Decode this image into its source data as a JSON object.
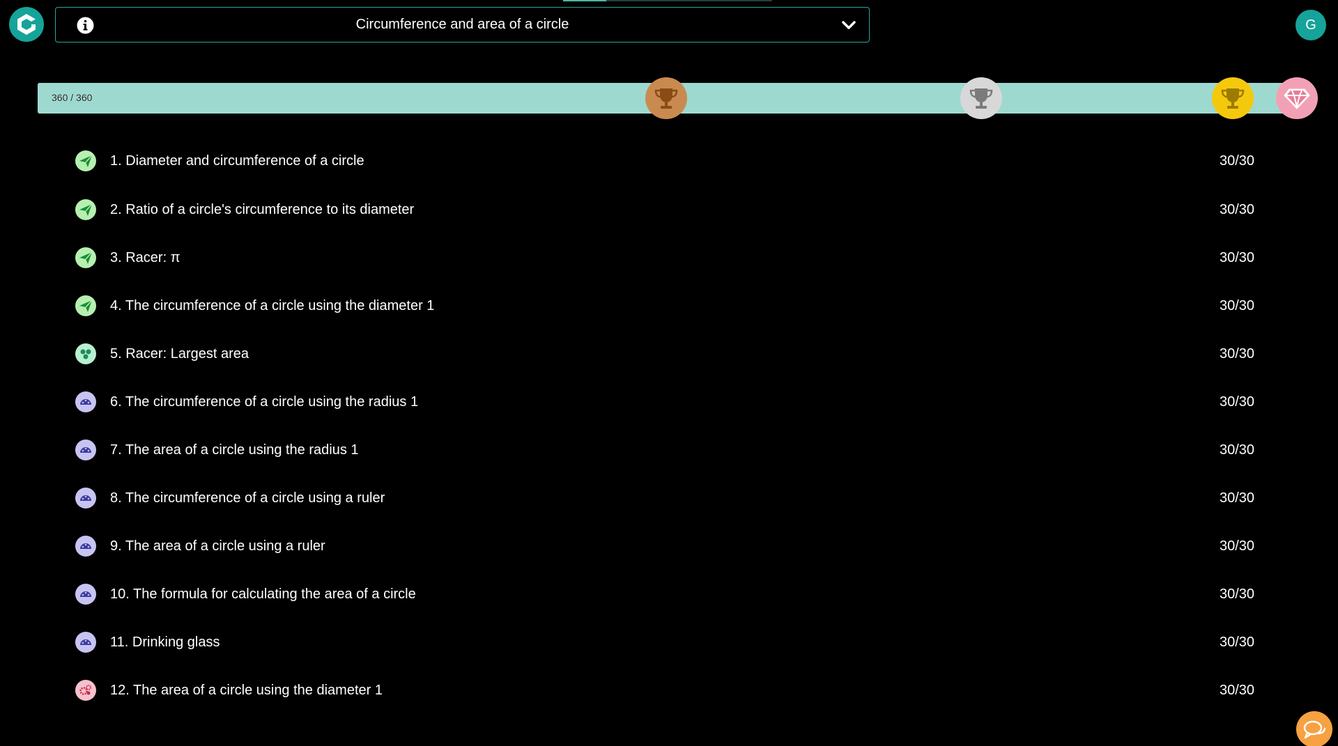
{
  "header": {
    "topic_title": "Circumference and area of a circle",
    "avatar_initial": "G"
  },
  "progress": {
    "label": "360 / 360",
    "value": 360,
    "max": 360
  },
  "colors": {
    "accent": "#26a69a",
    "progress": "#9ed9d0",
    "bronze": "#c98a4f",
    "silver": "#d8d8d8",
    "gold": "#f4c90d",
    "diamond": "#f2a1b5",
    "chat": "#f6a142"
  },
  "lessons": [
    {
      "label": "1. Diameter and circumference of a circle",
      "score": "30/30",
      "icon": "paper-plane-icon"
    },
    {
      "label": "2. Ratio of a circle's circumference to its diameter",
      "score": "30/30",
      "icon": "paper-plane-icon"
    },
    {
      "label": "3. Racer: π",
      "score": "30/30",
      "icon": "paper-plane-icon"
    },
    {
      "label": "4. The circumference of a circle using the diameter 1",
      "score": "30/30",
      "icon": "paper-plane-icon"
    },
    {
      "label": "5. Racer: Largest area",
      "score": "30/30",
      "icon": "racer-icon"
    },
    {
      "label": "6. The circumference of a circle using the radius 1",
      "score": "30/30",
      "icon": "gauge-icon"
    },
    {
      "label": "7. The area of a circle using the radius 1",
      "score": "30/30",
      "icon": "gauge-icon"
    },
    {
      "label": "8. The circumference of a circle using a ruler",
      "score": "30/30",
      "icon": "gauge-icon"
    },
    {
      "label": "9. The area of a circle using a ruler",
      "score": "30/30",
      "icon": "gauge-icon"
    },
    {
      "label": "10. The formula for calculating the area of a circle",
      "score": "30/30",
      "icon": "gauge-icon"
    },
    {
      "label": "11. Drinking glass",
      "score": "30/30",
      "icon": "gauge-icon"
    },
    {
      "label": "12. The area of a circle using the diameter 1",
      "score": "30/30",
      "icon": "gears-icon"
    }
  ]
}
